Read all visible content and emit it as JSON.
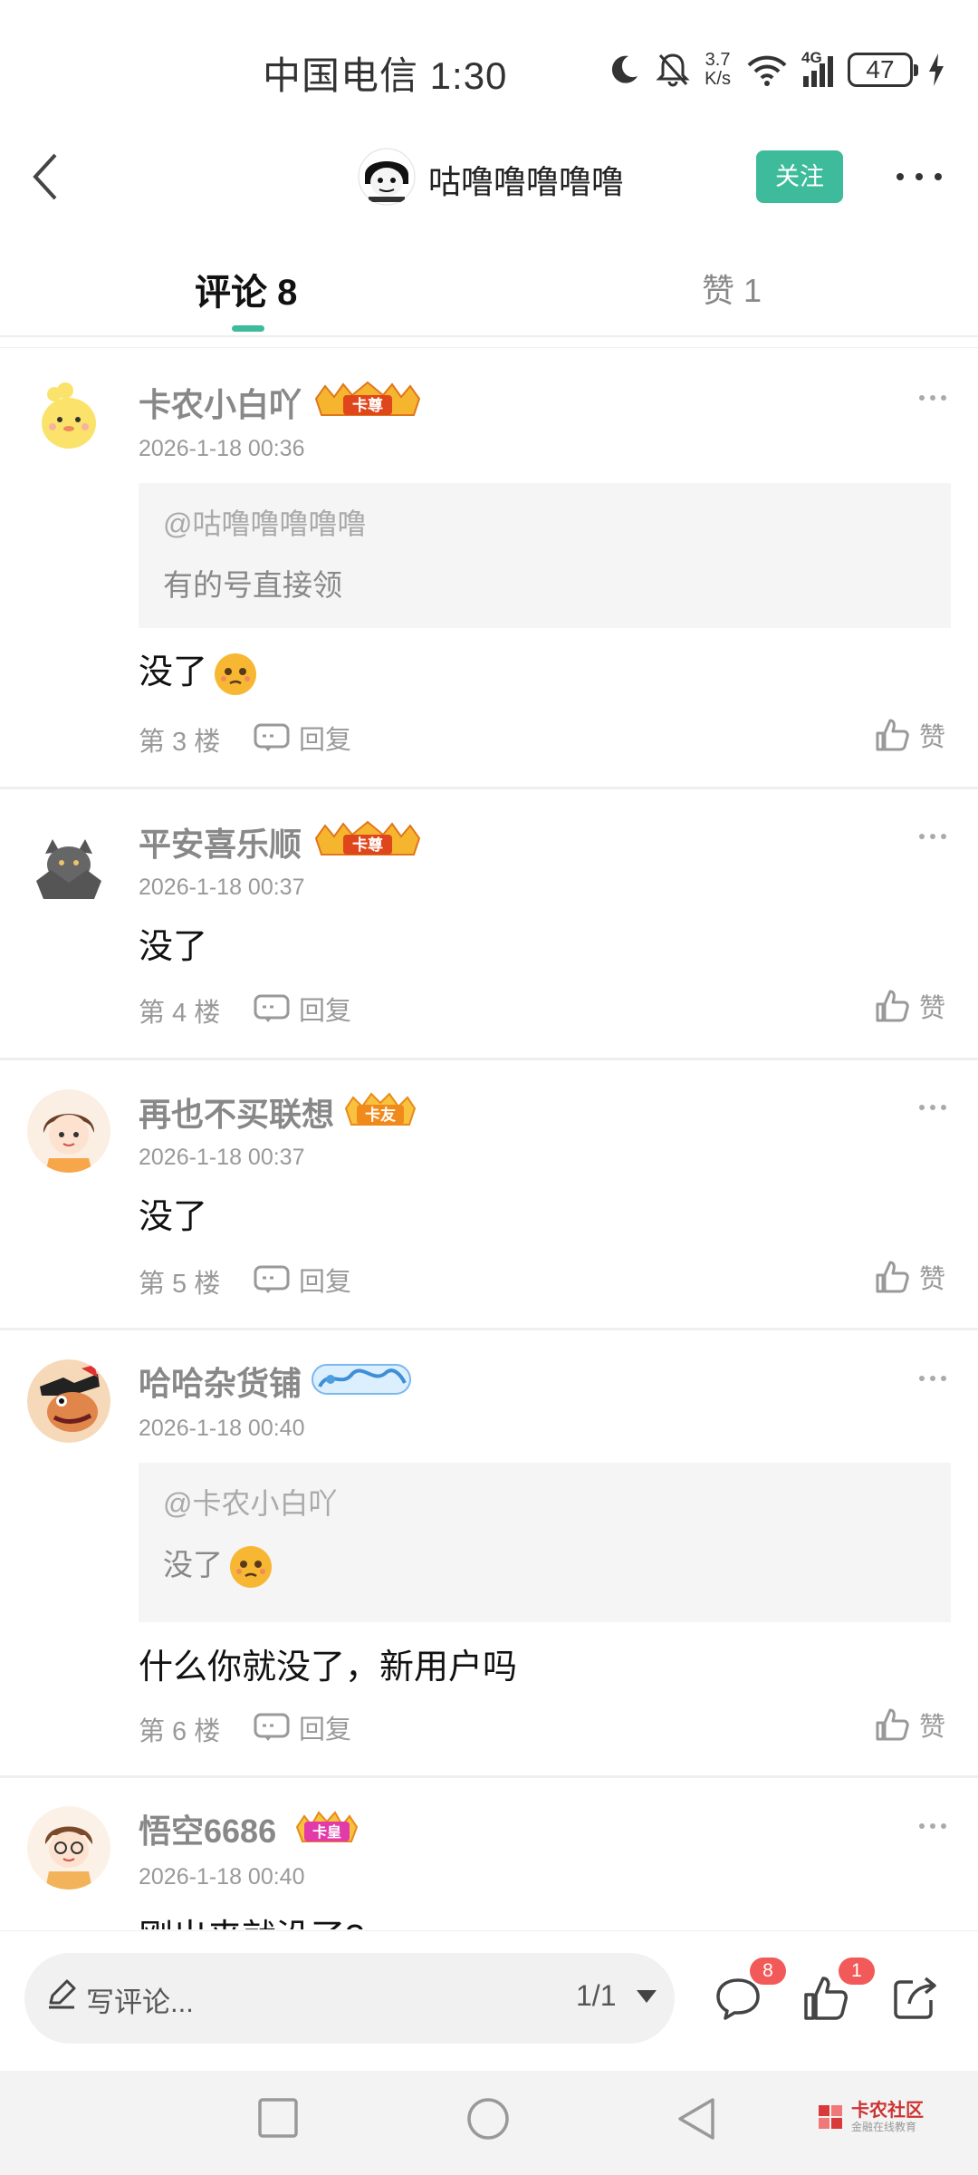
{
  "status_bar": {
    "carrier_time": "中国电信 1:30",
    "net_speed_value": "3.7",
    "net_speed_unit": "K/s",
    "signal": "4G",
    "battery": "47"
  },
  "header": {
    "username": "咕噜噜噜噜噜",
    "follow_label": "关注"
  },
  "tabs": {
    "comments": "评论 8",
    "likes": "赞 1"
  },
  "comments": [
    {
      "name": "卡农小白吖",
      "badge": "卡尊",
      "time": "2026-1-18 00:36",
      "quote_user": "@咕噜噜噜噜噜",
      "quote_text": "有的号直接领",
      "text": "没了",
      "floor": "第 3 楼",
      "reply": "回复",
      "like": "赞"
    },
    {
      "name": "平安喜乐顺",
      "badge": "卡尊",
      "time": "2026-1-18 00:37",
      "text": "没了",
      "floor": "第 4 楼",
      "reply": "回复",
      "like": "赞"
    },
    {
      "name": "再也不买联想",
      "badge": "卡友",
      "time": "2026-1-18 00:37",
      "text": "没了",
      "floor": "第 5 楼",
      "reply": "回复",
      "like": "赞"
    },
    {
      "name": "哈哈杂货铺",
      "time": "2026-1-18 00:40",
      "quote_user": "@卡农小白吖",
      "quote_text": "没了",
      "text": "什么你就没了，新用户吗",
      "floor": "第 6 楼",
      "reply": "回复",
      "like": "赞"
    },
    {
      "name": "悟空6686",
      "badge": "卡皇",
      "time": "2026-1-18 00:40",
      "text": "刚出来就没了?"
    }
  ],
  "bottom_bar": {
    "input_placeholder": "写评论...",
    "page": "1/1",
    "comment_count": "8",
    "like_count": "1"
  },
  "watermark": {
    "title": "卡农社区",
    "subtitle": "金融在线教育"
  },
  "colors": {
    "accent": "#3dbb9b",
    "badge_red": "#f25a5a"
  }
}
